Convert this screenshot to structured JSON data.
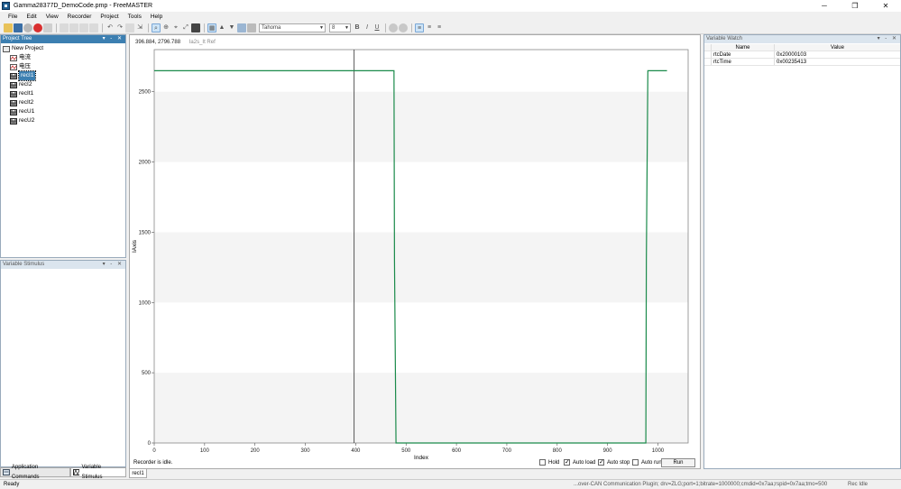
{
  "window": {
    "title": "Gamma28377D_DemoCode.pmp - FreeMASTER",
    "minimize": "─",
    "restore": "❐",
    "close": "✕"
  },
  "menu": [
    "File",
    "Edit",
    "View",
    "Recorder",
    "Project",
    "Tools",
    "Help"
  ],
  "toolbar": {
    "font_name": "Tahoma",
    "font_size": "8"
  },
  "project_tree": {
    "title": "Project Tree",
    "pane_controls": "▾ ‑ ✕",
    "root": "New Project",
    "items": [
      "电流",
      "电压",
      "recI1",
      "recI2",
      "recIt1",
      "recIt2",
      "recU1",
      "recU2"
    ]
  },
  "variable_stimulus": {
    "title": "Variable Stimulus",
    "pane_controls": "▾ ‑ ✕"
  },
  "bottom_tabs": [
    "Application Commands",
    "Variable Stimulus"
  ],
  "recorder": {
    "cursor_readout": "396.884, 2796.788",
    "legend_ref": "Ia2s_It Ref",
    "status": "Recorder is idle.",
    "options": [
      {
        "label": "Hold",
        "checked": false
      },
      {
        "label": "Auto load",
        "checked": true
      },
      {
        "label": "Auto stop",
        "checked": true
      },
      {
        "label": "Auto run",
        "checked": false
      }
    ],
    "run_label": "Run",
    "tab": "recI1"
  },
  "chart_data": {
    "type": "line",
    "xlabel": "Index",
    "ylabel": "IAxis",
    "xlim": [
      0,
      1060
    ],
    "ylim": [
      0,
      2800
    ],
    "x_ticks": [
      0,
      100,
      200,
      300,
      400,
      500,
      600,
      700,
      800,
      900,
      1000
    ],
    "y_ticks": [
      0,
      500,
      1000,
      1500,
      2000,
      2500
    ],
    "cursor_x": 396.884,
    "series": [
      {
        "color": "#1a8a4a",
        "x": [
          0,
          476,
          477,
          480,
          976,
          977,
          980,
          1018
        ],
        "y": [
          2650,
          2650,
          1300,
          0,
          0,
          1300,
          2650,
          2650
        ]
      }
    ]
  },
  "variable_watch": {
    "title": "Variable Watch",
    "pane_controls": "▾ ‑ ✕",
    "columns": [
      "Name",
      "Value"
    ],
    "rows": [
      {
        "name": "rtcDate",
        "value": "0x20000103"
      },
      {
        "name": "rtcTime",
        "value": "0x00235413"
      }
    ]
  },
  "statusbar": {
    "left": "Ready",
    "middle": "...over-CAN Communication Plugin; drv=ZLG;port=1;bitrate=1000000;cmdid=0x7aa;rspid=0x7aa;tmo=500",
    "right": "Rec Idle"
  }
}
